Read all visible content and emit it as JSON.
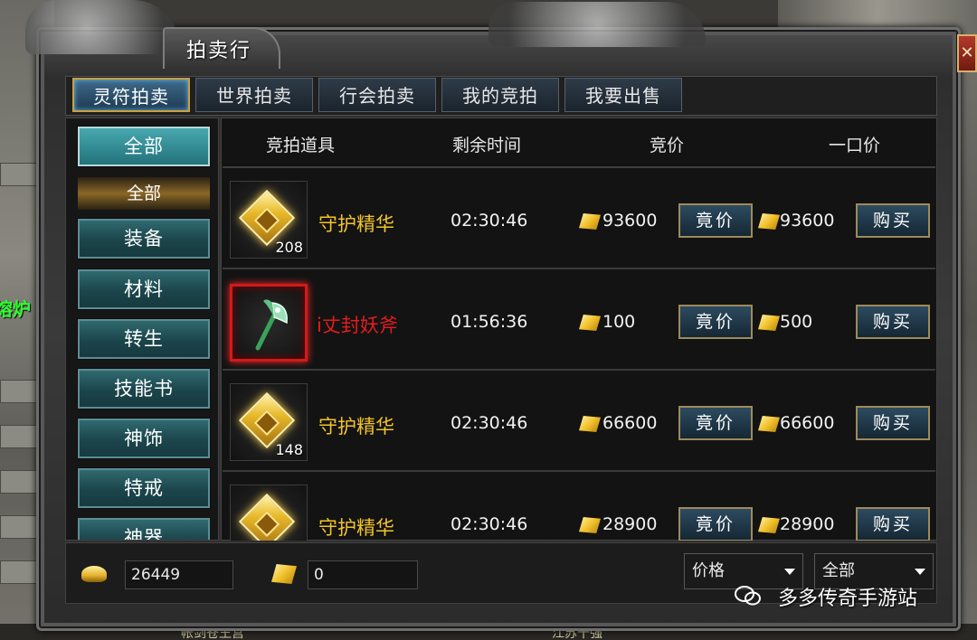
{
  "window": {
    "title": "拍卖行",
    "close_label": "✕"
  },
  "tabs": [
    {
      "label": "灵符拍卖",
      "active": true
    },
    {
      "label": "世界拍卖",
      "active": false
    },
    {
      "label": "行会拍卖",
      "active": false
    },
    {
      "label": "我的竞拍",
      "active": false
    },
    {
      "label": "我要出售",
      "active": false
    }
  ],
  "categories": {
    "all_label": "全部",
    "sub_selected": "全部",
    "items": [
      "装备",
      "材料",
      "转生",
      "技能书",
      "神饰",
      "特戒",
      "神器"
    ]
  },
  "table": {
    "headers": {
      "item": "竞拍道具",
      "time": "剩余时间",
      "bid": "竞价",
      "buyout": "一口价"
    },
    "bid_button": "竟价",
    "buy_button": "购买",
    "rows": [
      {
        "icon": "essence-icon",
        "qty": "208",
        "name": "守护精华",
        "rarity": "gold",
        "time": "02:30:46",
        "bid": "93600",
        "buyout": "93600"
      },
      {
        "icon": "axe-icon",
        "qty": "",
        "name": "i丈封妖斧",
        "rarity": "red",
        "time": "01:56:36",
        "bid": "100",
        "buyout": "500"
      },
      {
        "icon": "essence-icon",
        "qty": "148",
        "name": "守护精华",
        "rarity": "gold",
        "time": "02:30:46",
        "bid": "66600",
        "buyout": "66600"
      },
      {
        "icon": "essence-icon",
        "qty": "",
        "name": "守护精华",
        "rarity": "gold",
        "time": "02:30:46",
        "bid": "28900",
        "buyout": "28900"
      }
    ]
  },
  "footer": {
    "gold_value": "26449",
    "talisman_value": "0",
    "sort_select": "价格",
    "filter_select": "全部"
  },
  "background": {
    "left_label": "熔炉",
    "bottom_left": "帐剑苍王宫",
    "bottom_right": "江苏十强"
  },
  "watermark": "多多传奇手游站",
  "colors": {
    "item_gold": "#f3c42b",
    "item_red": "#e51c1c",
    "tab_active_border": "#c8a040",
    "category_teal": "#2f6a70"
  }
}
